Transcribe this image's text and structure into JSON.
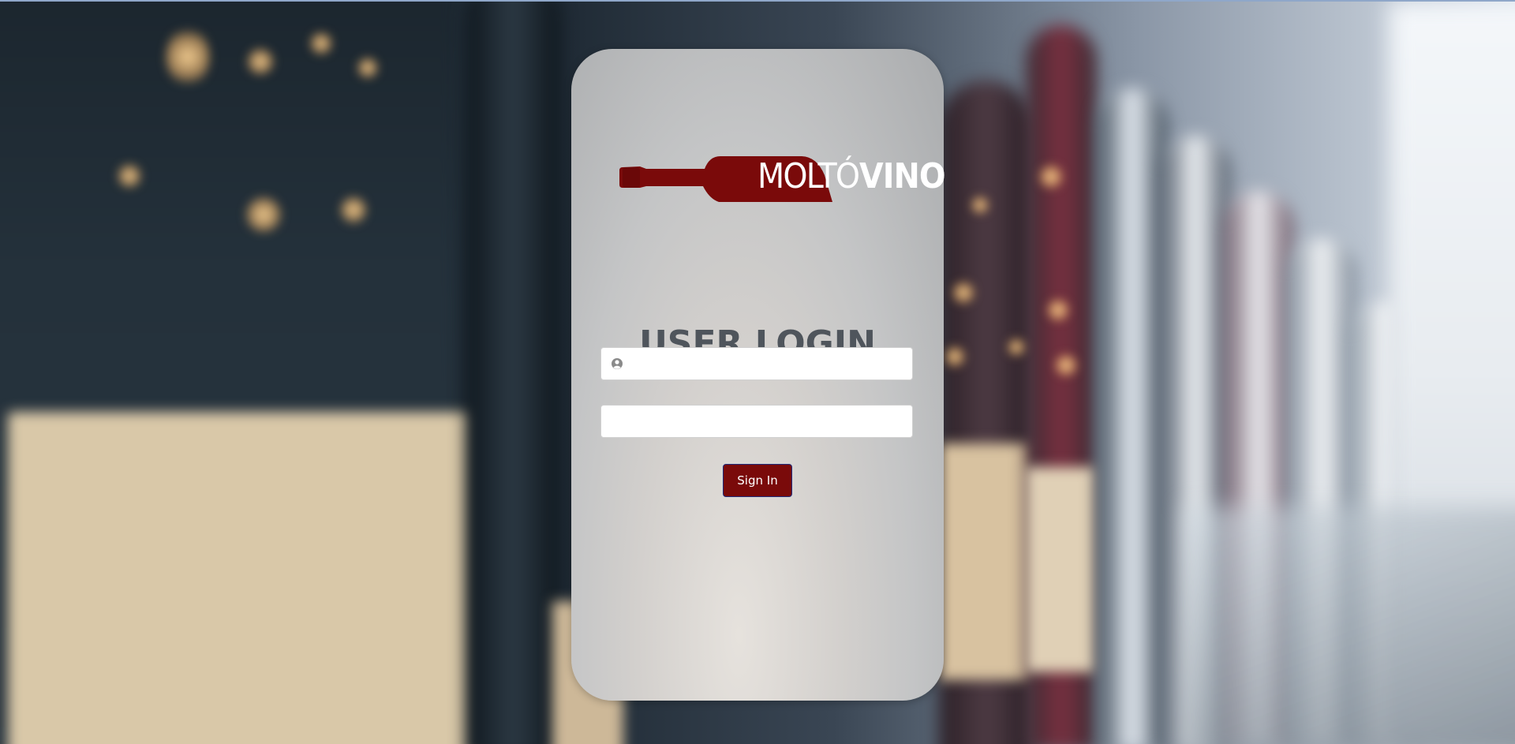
{
  "brand": {
    "name_part1": "MOLTÓ",
    "name_part2": "VINO",
    "logo_color": "#7a0a0a"
  },
  "login": {
    "title": "USER LOGIN",
    "username_value": "",
    "username_placeholder": "",
    "password_value": "",
    "password_placeholder": "",
    "username_icon": "user-circle-icon",
    "submit_label": "Sign In"
  },
  "colors": {
    "accent": "#7a0a0a",
    "button_border": "#1f2a7a",
    "title_text": "#4f555c"
  }
}
